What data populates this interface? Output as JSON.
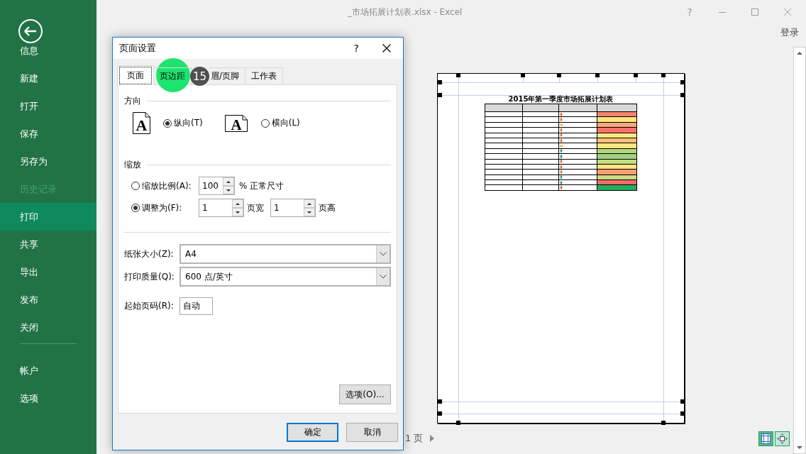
{
  "window": {
    "title": "_市场拓展计划表.xlsx - Excel",
    "controls": [
      {
        "kind": "help",
        "label": "?"
      },
      {
        "kind": "minimize"
      },
      {
        "kind": "maximize"
      },
      {
        "kind": "close"
      }
    ],
    "sign_in": "登录"
  },
  "sidebar": {
    "items": [
      {
        "label": "信息",
        "selected": false,
        "disabled": false
      },
      {
        "label": "新建",
        "selected": false,
        "disabled": false
      },
      {
        "label": "打开",
        "selected": false,
        "disabled": false
      },
      {
        "label": "保存",
        "selected": false,
        "disabled": false
      },
      {
        "label": "另存为",
        "selected": false,
        "disabled": false
      },
      {
        "label": "历史记录",
        "selected": false,
        "disabled": true
      },
      {
        "label": "打印",
        "selected": true,
        "disabled": false
      },
      {
        "label": "共享",
        "selected": false,
        "disabled": false
      },
      {
        "label": "导出",
        "selected": false,
        "disabled": false
      },
      {
        "label": "发布",
        "selected": false,
        "disabled": false
      },
      {
        "label": "关闭",
        "selected": false,
        "disabled": false
      }
    ],
    "footer_items": [
      {
        "label": "帐户",
        "selected": false,
        "disabled": false
      },
      {
        "label": "选项",
        "selected": false,
        "disabled": false
      }
    ]
  },
  "dialog": {
    "title": "页面设置",
    "help": "?",
    "tabs": [
      {
        "label": "页面",
        "selected": true,
        "highlighted": false
      },
      {
        "label": "页边距",
        "selected": false,
        "highlighted": true
      },
      {
        "label": "眉/页脚",
        "selected": false,
        "highlighted": false,
        "step_badge": "15"
      },
      {
        "label": "工作表",
        "selected": false,
        "highlighted": false
      }
    ],
    "orientation": {
      "heading": "方向",
      "options": [
        {
          "kind": "portrait",
          "glyph": "A",
          "label": "纵向(T)",
          "selected": true
        },
        {
          "kind": "landscape",
          "glyph": "A",
          "label": "横向(L)",
          "selected": false
        }
      ]
    },
    "scaling": {
      "heading": "缩放",
      "adjust_to": {
        "label": "缩放比例(A):",
        "selected": false,
        "value": "100",
        "suffix": "% 正常尺寸"
      },
      "fit_to": {
        "label": "调整为(F):",
        "selected": true,
        "wide_value": "1",
        "wide_label": "页宽",
        "tall_value": "1",
        "tall_label": "页高"
      }
    },
    "paper_size": {
      "label": "纸张大小(Z):",
      "value": "A4"
    },
    "print_quality": {
      "label": "打印质量(Q):",
      "value": "600 点/英寸"
    },
    "first_page_number": {
      "label": "起始页码(R):",
      "value": "自动"
    },
    "options_button": "选项(O)...",
    "buttons": [
      {
        "label": "确定",
        "default": true
      },
      {
        "label": "取消",
        "default": false
      }
    ]
  },
  "preview": {
    "title": "2015年第一季度市场拓展计划表",
    "rows": [
      {
        "kind": "down",
        "color": "#f8836d"
      },
      {
        "kind": "down",
        "color": "#fee582"
      },
      {
        "kind": "flat",
        "color": "#fba777"
      },
      {
        "kind": "down",
        "color": "#f8736c"
      },
      {
        "kind": "down",
        "color": "#feea83"
      },
      {
        "kind": "down",
        "color": "#fcbf7b"
      },
      {
        "kind": "flat",
        "color": "#fee683"
      },
      {
        "kind": "up",
        "color": "#b4d680"
      },
      {
        "kind": "up",
        "color": "#a2d07f"
      },
      {
        "kind": "down",
        "color": "#c8dc81"
      },
      {
        "kind": "down",
        "color": "#fee482"
      },
      {
        "kind": "down",
        "color": "#fa9e75"
      },
      {
        "kind": "up",
        "color": "#cbdc81"
      },
      {
        "kind": "up",
        "color": "#f8696b"
      },
      {
        "kind": "down",
        "color": "#22b05c"
      }
    ],
    "page_label": "1 页",
    "view_buttons": [
      {
        "kind": "margins",
        "selected": true
      },
      {
        "kind": "zoom_page",
        "selected": false
      }
    ]
  }
}
